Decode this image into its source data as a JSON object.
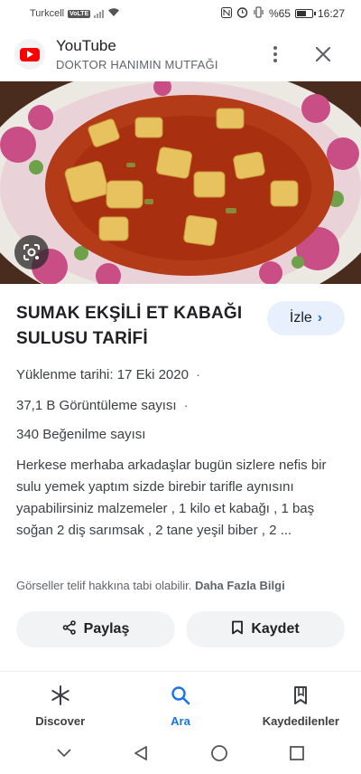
{
  "status_bar": {
    "carrier": "Turkcell",
    "network_badge": "VoLTE",
    "battery": "%65",
    "battery_level": 0.65,
    "time": "16:27"
  },
  "source": {
    "name": "YouTube",
    "channel": "DOKTOR HANIMIN MUTFAĞI",
    "icons": {
      "more": "more-vert-icon",
      "close": "close-icon"
    }
  },
  "hero": {
    "alt_icon": "lens-icon"
  },
  "video": {
    "title": "SUMAK EKŞİLİ ET KABAĞI SULUSU TARİFİ",
    "watch_label": "İzle",
    "upload_date": "Yüklenme tarihi: 17 Eki 2020",
    "views": "37,1 B Görüntüleme sayısı",
    "likes": "340 Beğenilme sayısı",
    "separator": "·",
    "description": "Herkese merhaba arkadaşlar bugün sizlere nefis bir sulu yemek yaptım sizde birebir tarifle aynısını yapabilirsiniz malzemeler , 1 kilo et kabağı , 1 baş soğan 2 diş sarımsak , 2 tane yeşil biber , 2 ...",
    "copyright_notice": "Görseller telif hakkına tabi olabilir.",
    "more_info_link": "Daha Fazla Bilgi"
  },
  "actions": {
    "share_label": "Paylaş",
    "save_label": "Kaydet"
  },
  "bottom_nav": {
    "items": [
      {
        "label": "Discover",
        "icon": "asterisk-icon"
      },
      {
        "label": "Ara",
        "icon": "search-icon"
      },
      {
        "label": "Kaydedilenler",
        "icon": "collections-icon"
      }
    ]
  },
  "colors": {
    "accent": "#1a73e8",
    "watch_bg": "#e8f0fe",
    "button_bg": "#f1f3f4",
    "youtube_red": "#ff0000"
  }
}
